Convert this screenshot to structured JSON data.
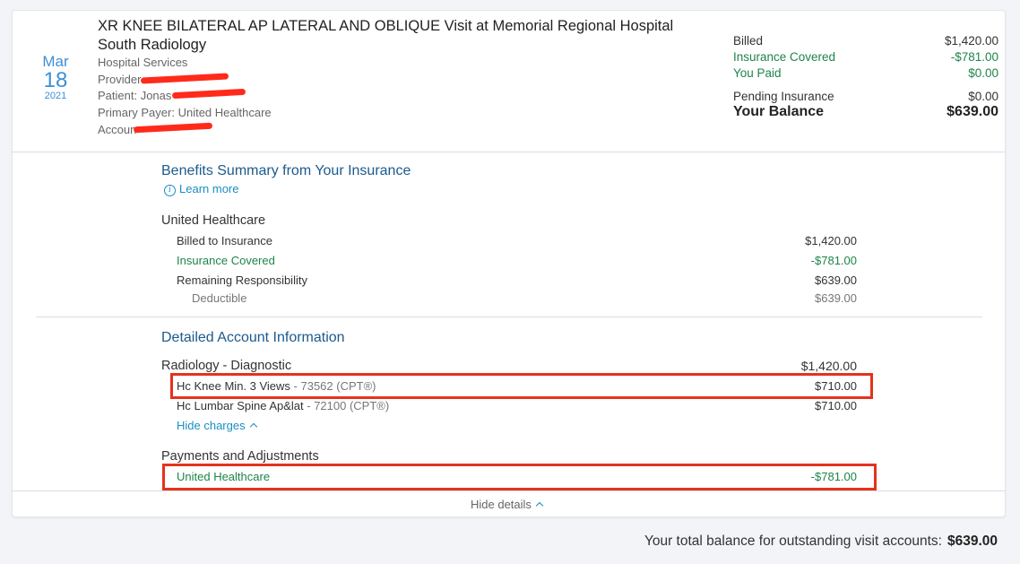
{
  "visit": {
    "month": "Mar",
    "day": "18",
    "year": "2021",
    "title": "XR KNEE BILATERAL AP LATERAL AND OBLIQUE Visit at Memorial Regional Hospital South Radiology",
    "service_type": "Hospital Services",
    "provider_label": "Provider",
    "patient_label": "Patient: Jonas",
    "primary_payer": "Primary Payer: United Healthcare",
    "account_label": "Accoun"
  },
  "summary": {
    "billed_label": "Billed",
    "billed_value": "$1,420.00",
    "covered_label": "Insurance Covered",
    "covered_value": "-$781.00",
    "paid_label": "You Paid",
    "paid_value": "$0.00",
    "pending_label": "Pending Insurance",
    "pending_value": "$0.00",
    "balance_label": "Your Balance",
    "balance_value": "$639.00"
  },
  "benefits": {
    "title": "Benefits Summary from Your Insurance",
    "learn_more": "Learn more",
    "insurer": "United Healthcare",
    "billed_label": "Billed to Insurance",
    "billed_value": "$1,420.00",
    "covered_label": "Insurance Covered",
    "covered_value": "-$781.00",
    "remaining_label": "Remaining Responsibility",
    "remaining_value": "$639.00",
    "deductible_label": "Deductible",
    "deductible_value": "$639.00"
  },
  "detail": {
    "title": "Detailed Account Information",
    "category": "Radiology - Diagnostic",
    "category_total": "$1,420.00",
    "charges": [
      {
        "name": "Hc Knee Min. 3 Views",
        "code": " - 73562 (CPT®)",
        "amount": "$710.00"
      },
      {
        "name": "Hc Lumbar Spine Ap&lat",
        "code": " - 72100 (CPT®)",
        "amount": "$710.00"
      }
    ],
    "hide_charges": "Hide charges",
    "payments_title": "Payments and Adjustments",
    "payment_name": "United Healthcare",
    "payment_amount": "-$781.00"
  },
  "hide_details": "Hide details",
  "footer": {
    "label": "Your total balance for outstanding visit accounts:",
    "value": "$639.00"
  },
  "colors": {
    "accent": "#3d8fd6",
    "heading": "#1c5a8c",
    "link": "#1a8fc1",
    "green": "#1e8449",
    "highlight": "#e5321c"
  }
}
